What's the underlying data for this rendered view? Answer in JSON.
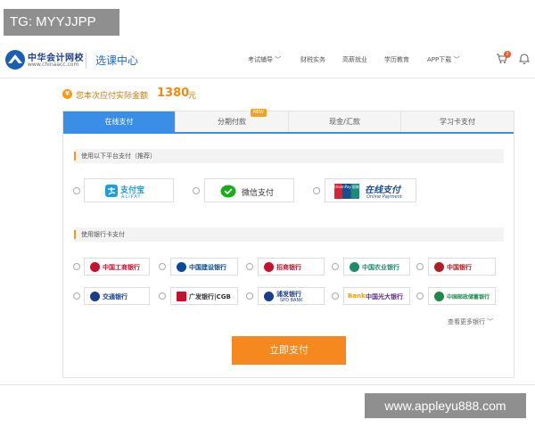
{
  "overlay": {
    "tg_label": "TG: MYYJJPP",
    "watermark_url": "www.appleyu888.com"
  },
  "header": {
    "logo_cn": "中华会计网校",
    "logo_en": "www.chinaacc.com",
    "site_title": "选课中心",
    "nav": [
      "考试辅导 ﹀",
      "财税实务",
      "高薪就业",
      "学历教育",
      "APP下载 ﹀"
    ],
    "cart_count": "2"
  },
  "amount": {
    "label": "您本次应付实际金额",
    "value": "1380",
    "unit": "元",
    "icon_text": "¥"
  },
  "tabs": [
    {
      "label": "在线支付",
      "active": true
    },
    {
      "label": "分期付款",
      "badge": "NEW"
    },
    {
      "label": "现金/汇款"
    },
    {
      "label": "学习卡支付"
    }
  ],
  "platform_section": {
    "title": "使用以下平台支付（推荐）",
    "options": [
      {
        "name": "支付宝",
        "sub": "ALIPAY",
        "icon": "alipay-icon",
        "color": "#1a9fe0"
      },
      {
        "name": "微信支付",
        "icon": "wechat-icon",
        "color": "#1aad19"
      },
      {
        "name": "在线支付",
        "sub": "Online Payment",
        "brand": "UnionPay 银联",
        "icon": "unionpay-icon",
        "color": "#1a4d8f"
      }
    ]
  },
  "bank_section": {
    "title": "使用银行卡支付",
    "banks": [
      {
        "name": "中国工商银行",
        "icon": "icbc-icon",
        "color": "#c8102e"
      },
      {
        "name": "中国建设银行",
        "icon": "ccb-icon",
        "color": "#0a4a9a"
      },
      {
        "name": "招商银行",
        "icon": "cmb-icon",
        "color": "#c8102e"
      },
      {
        "name": "中国农业银行",
        "icon": "abc-icon",
        "color": "#1d8a6b"
      },
      {
        "name": "中国银行",
        "icon": "boc-icon",
        "color": "#b01e23"
      },
      {
        "name": "交通银行",
        "icon": "bocom-icon",
        "color": "#1a3e8c"
      },
      {
        "name": "广发银行|CGB",
        "icon": "cgb-icon",
        "color": "#c8102e"
      },
      {
        "name": "浦发银行",
        "sub": "SPD BANK",
        "icon": "spdb-icon",
        "color": "#1a3e8c"
      },
      {
        "name": "中国光大银行",
        "prefix": "Bank",
        "icon": "ceb-icon",
        "color": "#f2a000"
      },
      {
        "name": "中国邮政储蓄银行",
        "icon": "psbc-icon",
        "color": "#1d8a4a"
      }
    ],
    "more_label": "查看更多银行 ﹀"
  },
  "pay_button_label": "立即支付"
}
